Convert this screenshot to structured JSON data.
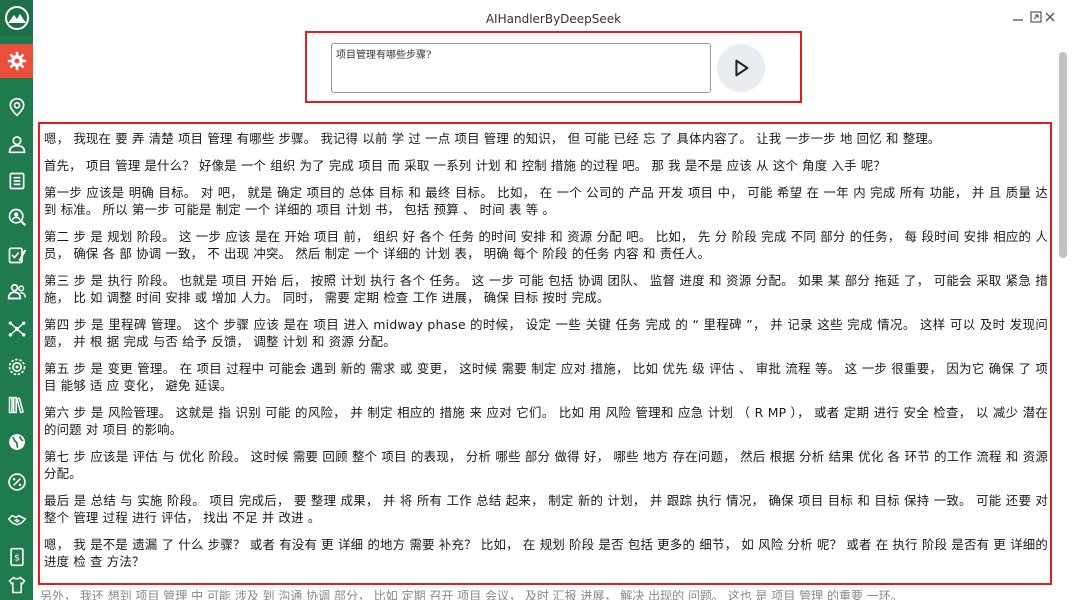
{
  "window": {
    "title": "AIHandlerByDeepSeek"
  },
  "sidebar": {
    "logo_icon": "mountain-logo-icon",
    "items": [
      {
        "icon": "gear-icon",
        "active": true
      },
      {
        "icon": "location-pin-icon"
      },
      {
        "icon": "user-icon"
      },
      {
        "icon": "document-list-icon"
      },
      {
        "icon": "user-search-icon"
      },
      {
        "icon": "checklist-edit-icon"
      },
      {
        "icon": "users-group-icon"
      },
      {
        "icon": "network-nodes-icon"
      },
      {
        "icon": "target-gear-icon"
      },
      {
        "icon": "library-books-icon"
      },
      {
        "icon": "globe-icon"
      },
      {
        "icon": "percent-circle-icon"
      },
      {
        "icon": "handshake-icon"
      },
      {
        "icon": "money-bill-icon"
      },
      {
        "icon": "shirt-icon"
      }
    ],
    "colors": {
      "background": "#1f7a4d",
      "active": "#e94f3b"
    }
  },
  "question": {
    "value": "项目管理有哪些步骤?"
  },
  "send_button": {
    "icon": "play-send-icon"
  },
  "answer": {
    "paragraphs": [
      "嗯， 我现在 要 弄 清楚 项目 管理 有哪些 步骤。 我记得 以前 学 过 一点 项目 管理 的知识， 但 可能 已经 忘 了 具体内容了。 让我 一步一步 地 回忆 和 整理。",
      "首先， 项目 管理 是什么？ 好像是 一个 组织 为了 完成 项目 而 采取 一系列 计划 和 控制 措施 的过程 吧。 那 我 是不是 应该 从 这个 角度 入手 呢？",
      "第一步 应该是 明确 目标。 对 吧， 就是 确定 项目的 总体 目标 和 最终 目标。 比如， 在 一个 公司的 产品 开发 项目 中， 可能 希望 在 一年 内 完成 所有 功能， 并 且 质量 达到 标准。 所以 第一步 可能是 制定 一个 详细的 项目 计划 书， 包括 预算 、 时间 表 等 。",
      "第二 步 是 规划 阶段。 这 一步 应该 是在 开始 项目 前， 组织 好 各个 任务 的时间 安排 和 资源 分配 吧。 比如， 先 分 阶段 完成 不同 部分 的任务， 每 段时间 安排 相应的 人员， 确保 各 部 协调 一致， 不 出现 冲突。 然后 制定 一个 详细的 计划 表， 明确 每个 阶段 的任务 内容 和 责任人。",
      "第三 步 是 执行 阶段。 也就是 项目 开始 后， 按照 计划 执行 各个 任务。 这 一步 可能 包括 协调 团队、 监督 进度 和 资源 分配。 如果 某 部分 拖延 了， 可能会 采取 紧急 措施， 比 如 调整 时间 安排 或 增加 人力。 同时， 需要 定期 检查 工作 进展， 确保 目标 按时 完成。",
      "第四 步 是 里程碑 管理。 这个 步骤 应该 是在 项目 进入 midway phase 的时候， 设定 一些 关键 任务 完成 的 “ 里程碑 ”， 并 记录 这些 完成 情况。 这样 可以 及时 发现问题， 并 根 据 完成 与否 给予 反馈， 调整 计划 和 资源 分配。",
      "第五 步 是 变更 管理。 在 项目 过程中 可能会 遇到 新的 需求 或 变更， 这时候 需要 制定 应对 措施， 比如 优先 级 评估 、 审批 流程 等。 这 一步 很重要， 因为它 确保 了 项目 能够 适 应 变化， 避免 延误。",
      "第六 步 是 风险管理。 这就是 指 识别 可能 的风险， 并 制定 相应的 措施 来 应对 它们。 比如 用 风险 管理和 应急 计划 （ R MP ）， 或者 定期 进行 安全 检查， 以 减少 潜在 的问题 对 项目 的影响。",
      "第七 步 应该是 评估 与 优化 阶段。 这时候 需要 回顾 整个 项目 的表现， 分析 哪些 部分 做得 好， 哪些 地方 存在问题， 然后 根据 分析 结果 优化 各 环节 的工作 流程 和 资源 分配。",
      "最后 是 总结 与 实施 阶段。 项目 完成后， 要 整理 成果， 并 将 所有 工作 总结 起来， 制定 新的 计划， 并 跟踪 执行 情况， 确保 项目 目标 和 目标 保持 一致。 可能 还要 对 整个 管理 过程 进行 评估， 找出 不足 并 改进 。",
      "嗯， 我 是不是 遗漏 了 什么 步骤？ 或者 有没有 更 详细 的地方 需要 补充？ 比如， 在 规划 阶段 是否 包括 更多的 细节， 如 风险 分析 呢？ 或者 在 执行 阶段 是否有 更 详细的 进度 检 查 方法？"
    ],
    "residual_line": "另外， 我还 想到 项目 管理 中 可能 涉及 到 沟通 协调 部分， 比如 定期 召开 项目 会议， 及时 汇报 进展， 解决 出现的 问题。 这也 是 项目 管理 的重要 一环。"
  },
  "window_controls": {
    "minimize_icon": "minimize-icon",
    "restore_icon": "restore-icon",
    "close_icon": "close-icon"
  },
  "colors": {
    "highlight_border": "#e21d1d",
    "send_button_bg": "#e9edf1"
  }
}
